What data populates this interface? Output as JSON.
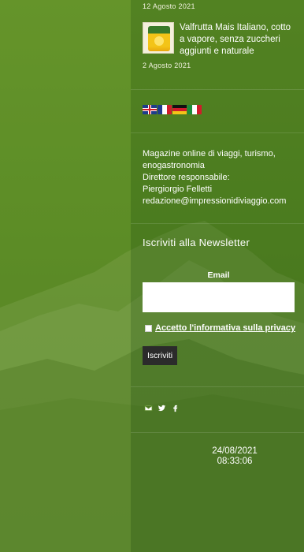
{
  "recent_posts": {
    "first_date": "12 Agosto 2021",
    "second": {
      "title": "Valfrutta Mais Italiano, cotto a vapore, senza zuccheri aggiunti e naturale",
      "date": "2 Agosto 2021",
      "thumb_icon": "corn-can-thumbnail"
    }
  },
  "languages": [
    {
      "name": "English",
      "icon": "flag-uk-icon"
    },
    {
      "name": "Français",
      "icon": "flag-fr-icon"
    },
    {
      "name": "Deutsch",
      "icon": "flag-de-icon"
    },
    {
      "name": "Italiano",
      "icon": "flag-it-icon"
    }
  ],
  "about": {
    "line1": "Magazine online di viaggi, turismo,",
    "line2": "enogastronomia",
    "line3": "Direttore responsabile:",
    "line4": "Piergiorgio Felletti",
    "line5": "redazione@impressionidiviaggio.com"
  },
  "newsletter": {
    "title": "Iscriviti alla Newsletter",
    "email_label": "Email",
    "email_value": "",
    "privacy_label": "Accetto l'informativa sulla privacy",
    "submit_label": "Iscriviti"
  },
  "social": [
    "email-icon",
    "twitter-icon",
    "facebook-icon"
  ],
  "clock": {
    "date": "24/08/2021",
    "time": "08:33:06"
  },
  "colors": {
    "background": "#5a8a2a",
    "button": "#2b2b2b",
    "text": "#ffffff"
  }
}
